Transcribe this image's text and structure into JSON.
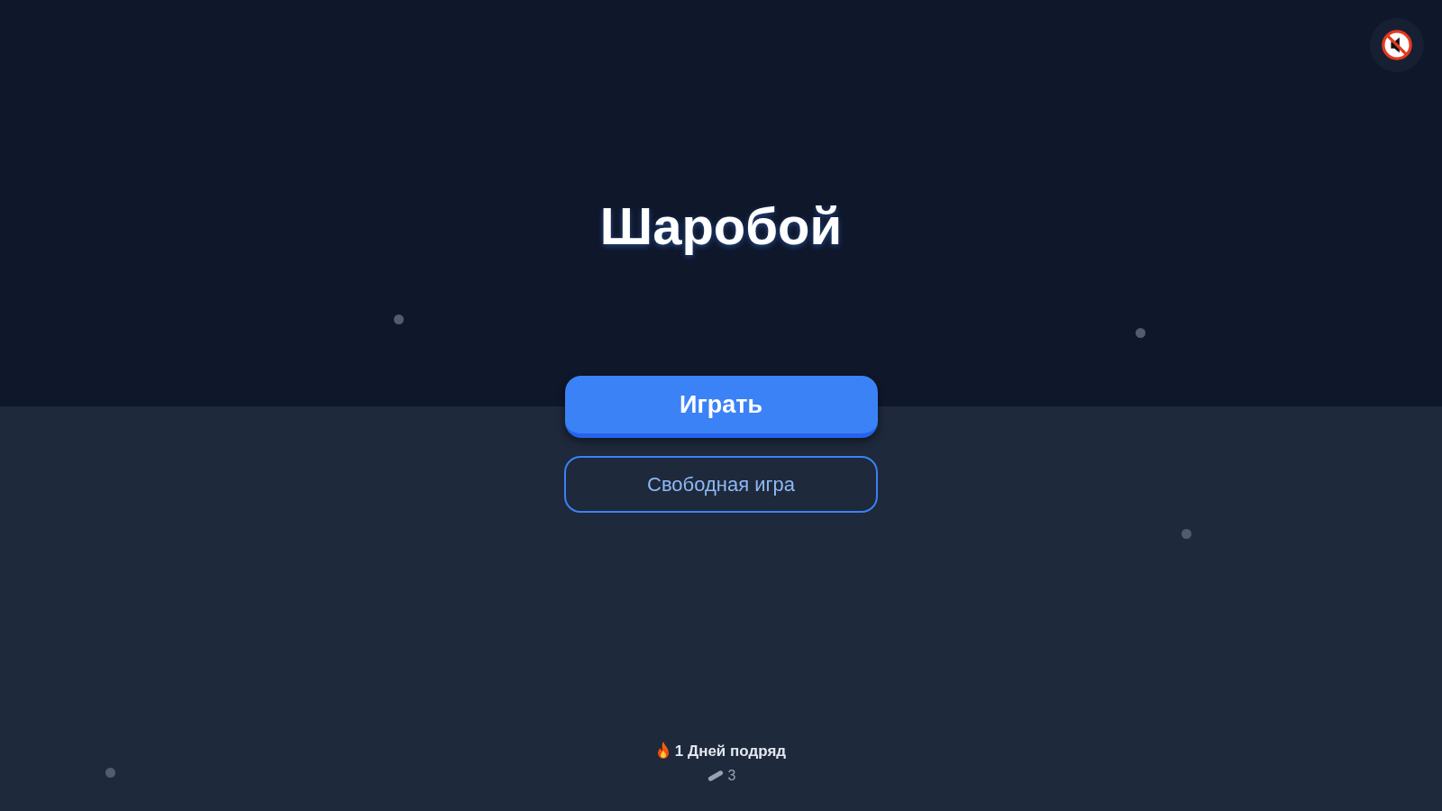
{
  "sound_button": {
    "muted": true
  },
  "title": "Шаробой",
  "buttons": [
    {
      "label": "Играть",
      "kind": "primary"
    },
    {
      "label": "Свободная игра",
      "kind": "outline"
    }
  ],
  "streak": {
    "text": "1 Дней подряд"
  },
  "balance": {
    "value": "3"
  }
}
